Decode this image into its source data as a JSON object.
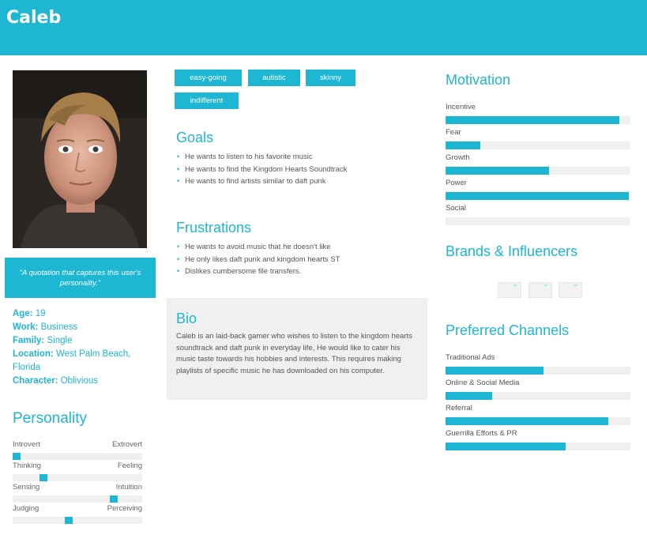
{
  "header": {
    "name": "Caleb"
  },
  "quote": "\"A quotation that captures this user's personality.\"",
  "info": [
    {
      "label": "Age:",
      "value": "19"
    },
    {
      "label": "Work:",
      "value": "Business"
    },
    {
      "label": "Family:",
      "value": "Single"
    },
    {
      "label": "Location:",
      "value": "West Palm Beach, Florida"
    },
    {
      "label": "Character:",
      "value": "Oblivious"
    }
  ],
  "personality": {
    "title": "Personality",
    "traits": [
      {
        "left": "Introvert",
        "right": "Extrovert",
        "level": 0.0
      },
      {
        "left": "Thinking",
        "right": "Feeling",
        "level": 0.22
      },
      {
        "left": "Sensing",
        "right": "Intuition",
        "level": 0.8
      },
      {
        "left": "Judging",
        "right": "Perceiving",
        "level": 0.43
      }
    ]
  },
  "tags": [
    "easy-going",
    "autistic",
    "skinny",
    "indifferent"
  ],
  "goals": {
    "title": "Goals",
    "items": [
      "He wants to listen to his favorite music",
      "He wants to find the Kingdom Hearts Soundtrack",
      "He wants to find artists similar to daft punk"
    ]
  },
  "frustrations": {
    "title": "Frustrations",
    "items": [
      "He wants to avoid music that he doesn't like",
      "He only likes daft punk and kingdom hearts ST",
      "Dislikes cumbersome file transfers."
    ]
  },
  "bio": {
    "title": "Bio",
    "text": "Caleb is an laid-back gamer who wishes to listen to the kingdom hearts soundtrack and daft punk in everyday life, He would like to cater his music taste towards his hobbies and interests. This requires making playlists of specific music he has downloaded on his computer."
  },
  "motivation": {
    "title": "Motivation",
    "items": [
      {
        "label": "Incentive",
        "level": 0.94
      },
      {
        "label": "Fear",
        "level": 0.19
      },
      {
        "label": "Growth",
        "level": 0.56
      },
      {
        "label": "Power",
        "level": 0.99
      },
      {
        "label": "Social",
        "level": 0.0
      }
    ]
  },
  "brands": {
    "title": "Brands & Influencers"
  },
  "channels": {
    "title": "Preferred Channels",
    "items": [
      {
        "label": "Traditional Ads",
        "level": 0.53
      },
      {
        "label": "Online & Social Media",
        "level": 0.25
      },
      {
        "label": "Referral",
        "level": 0.88
      },
      {
        "label": "Guerrilla Efforts & PR",
        "level": 0.65
      }
    ]
  },
  "colors": {
    "accent": "#1db7d3",
    "track": "#f0f0f0"
  }
}
